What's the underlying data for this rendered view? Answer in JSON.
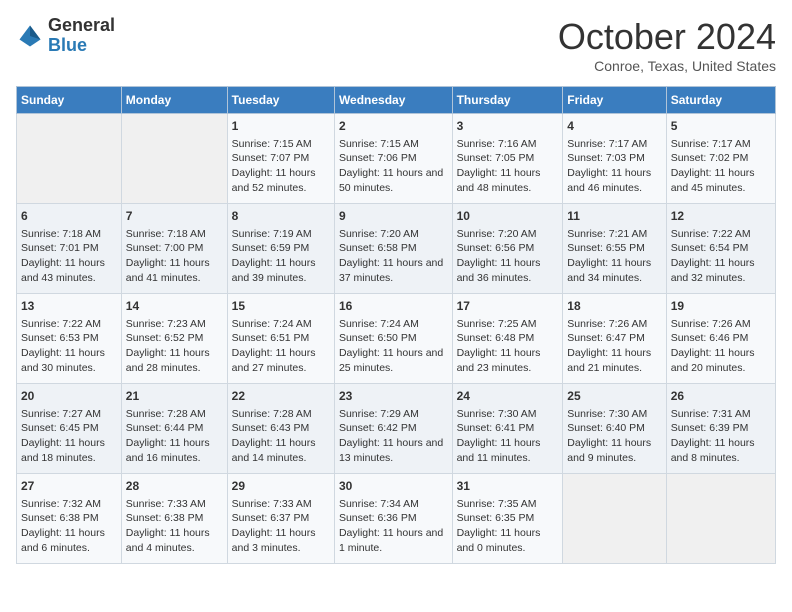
{
  "header": {
    "logo_general": "General",
    "logo_blue": "Blue",
    "month_title": "October 2024",
    "subtitle": "Conroe, Texas, United States"
  },
  "days_of_week": [
    "Sunday",
    "Monday",
    "Tuesday",
    "Wednesday",
    "Thursday",
    "Friday",
    "Saturday"
  ],
  "weeks": [
    [
      {
        "day": "",
        "text": ""
      },
      {
        "day": "",
        "text": ""
      },
      {
        "day": "1",
        "text": "Sunrise: 7:15 AM\nSunset: 7:07 PM\nDaylight: 11 hours and 52 minutes."
      },
      {
        "day": "2",
        "text": "Sunrise: 7:15 AM\nSunset: 7:06 PM\nDaylight: 11 hours and 50 minutes."
      },
      {
        "day": "3",
        "text": "Sunrise: 7:16 AM\nSunset: 7:05 PM\nDaylight: 11 hours and 48 minutes."
      },
      {
        "day": "4",
        "text": "Sunrise: 7:17 AM\nSunset: 7:03 PM\nDaylight: 11 hours and 46 minutes."
      },
      {
        "day": "5",
        "text": "Sunrise: 7:17 AM\nSunset: 7:02 PM\nDaylight: 11 hours and 45 minutes."
      }
    ],
    [
      {
        "day": "6",
        "text": "Sunrise: 7:18 AM\nSunset: 7:01 PM\nDaylight: 11 hours and 43 minutes."
      },
      {
        "day": "7",
        "text": "Sunrise: 7:18 AM\nSunset: 7:00 PM\nDaylight: 11 hours and 41 minutes."
      },
      {
        "day": "8",
        "text": "Sunrise: 7:19 AM\nSunset: 6:59 PM\nDaylight: 11 hours and 39 minutes."
      },
      {
        "day": "9",
        "text": "Sunrise: 7:20 AM\nSunset: 6:58 PM\nDaylight: 11 hours and 37 minutes."
      },
      {
        "day": "10",
        "text": "Sunrise: 7:20 AM\nSunset: 6:56 PM\nDaylight: 11 hours and 36 minutes."
      },
      {
        "day": "11",
        "text": "Sunrise: 7:21 AM\nSunset: 6:55 PM\nDaylight: 11 hours and 34 minutes."
      },
      {
        "day": "12",
        "text": "Sunrise: 7:22 AM\nSunset: 6:54 PM\nDaylight: 11 hours and 32 minutes."
      }
    ],
    [
      {
        "day": "13",
        "text": "Sunrise: 7:22 AM\nSunset: 6:53 PM\nDaylight: 11 hours and 30 minutes."
      },
      {
        "day": "14",
        "text": "Sunrise: 7:23 AM\nSunset: 6:52 PM\nDaylight: 11 hours and 28 minutes."
      },
      {
        "day": "15",
        "text": "Sunrise: 7:24 AM\nSunset: 6:51 PM\nDaylight: 11 hours and 27 minutes."
      },
      {
        "day": "16",
        "text": "Sunrise: 7:24 AM\nSunset: 6:50 PM\nDaylight: 11 hours and 25 minutes."
      },
      {
        "day": "17",
        "text": "Sunrise: 7:25 AM\nSunset: 6:48 PM\nDaylight: 11 hours and 23 minutes."
      },
      {
        "day": "18",
        "text": "Sunrise: 7:26 AM\nSunset: 6:47 PM\nDaylight: 11 hours and 21 minutes."
      },
      {
        "day": "19",
        "text": "Sunrise: 7:26 AM\nSunset: 6:46 PM\nDaylight: 11 hours and 20 minutes."
      }
    ],
    [
      {
        "day": "20",
        "text": "Sunrise: 7:27 AM\nSunset: 6:45 PM\nDaylight: 11 hours and 18 minutes."
      },
      {
        "day": "21",
        "text": "Sunrise: 7:28 AM\nSunset: 6:44 PM\nDaylight: 11 hours and 16 minutes."
      },
      {
        "day": "22",
        "text": "Sunrise: 7:28 AM\nSunset: 6:43 PM\nDaylight: 11 hours and 14 minutes."
      },
      {
        "day": "23",
        "text": "Sunrise: 7:29 AM\nSunset: 6:42 PM\nDaylight: 11 hours and 13 minutes."
      },
      {
        "day": "24",
        "text": "Sunrise: 7:30 AM\nSunset: 6:41 PM\nDaylight: 11 hours and 11 minutes."
      },
      {
        "day": "25",
        "text": "Sunrise: 7:30 AM\nSunset: 6:40 PM\nDaylight: 11 hours and 9 minutes."
      },
      {
        "day": "26",
        "text": "Sunrise: 7:31 AM\nSunset: 6:39 PM\nDaylight: 11 hours and 8 minutes."
      }
    ],
    [
      {
        "day": "27",
        "text": "Sunrise: 7:32 AM\nSunset: 6:38 PM\nDaylight: 11 hours and 6 minutes."
      },
      {
        "day": "28",
        "text": "Sunrise: 7:33 AM\nSunset: 6:38 PM\nDaylight: 11 hours and 4 minutes."
      },
      {
        "day": "29",
        "text": "Sunrise: 7:33 AM\nSunset: 6:37 PM\nDaylight: 11 hours and 3 minutes."
      },
      {
        "day": "30",
        "text": "Sunrise: 7:34 AM\nSunset: 6:36 PM\nDaylight: 11 hours and 1 minute."
      },
      {
        "day": "31",
        "text": "Sunrise: 7:35 AM\nSunset: 6:35 PM\nDaylight: 11 hours and 0 minutes."
      },
      {
        "day": "",
        "text": ""
      },
      {
        "day": "",
        "text": ""
      }
    ]
  ]
}
